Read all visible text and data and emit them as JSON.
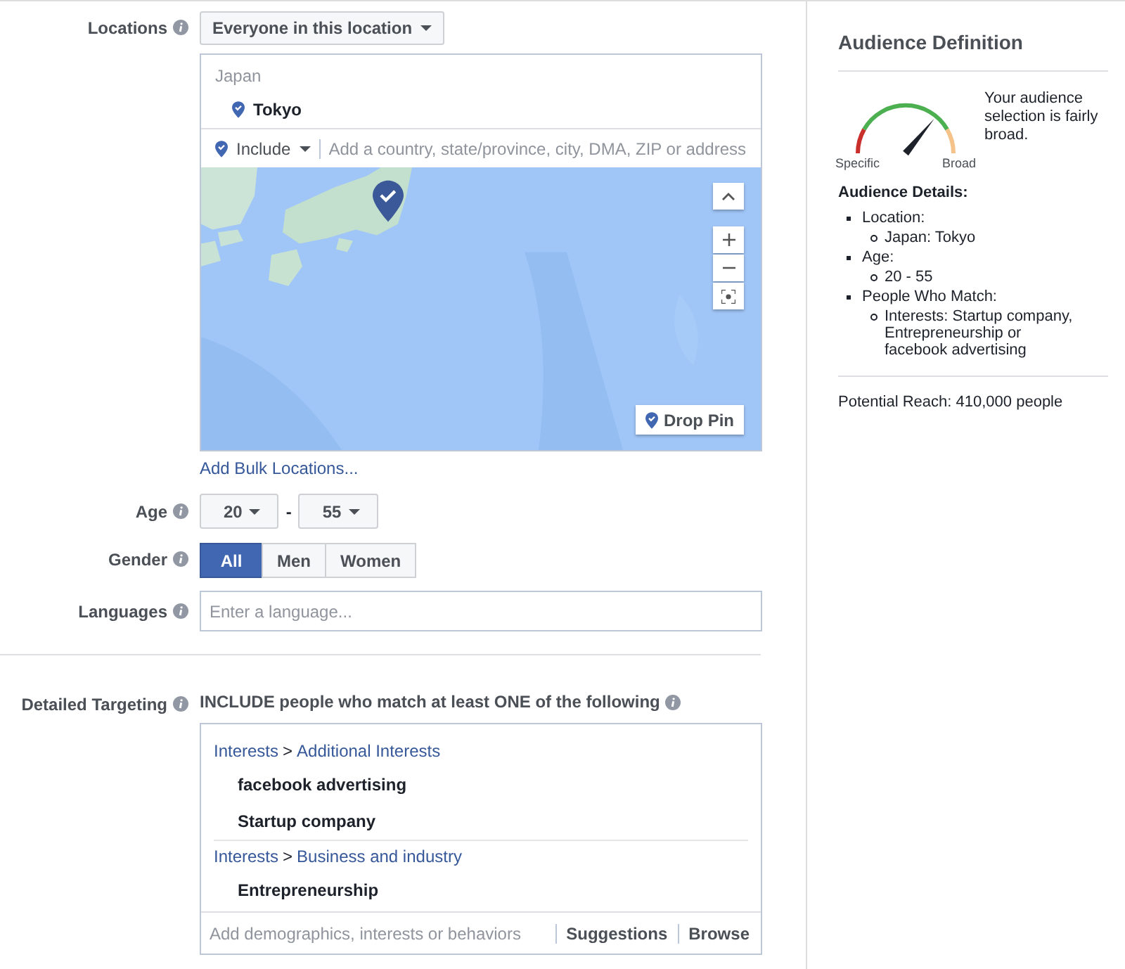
{
  "locations": {
    "label": "Locations",
    "mode": "Everyone in this location",
    "selected": [
      {
        "country": "Japan",
        "places": [
          "Tokyo"
        ]
      }
    ],
    "include": "Include",
    "search_placeholder": "Add a country, state/province, city, DMA, ZIP or address",
    "map": {
      "kind": "picture",
      "drop_pin": "Drop Pin"
    },
    "bulk_link": "Add Bulk Locations..."
  },
  "age": {
    "label": "Age",
    "min": "20",
    "separator": "-",
    "max": "55"
  },
  "gender": {
    "label": "Gender",
    "options": [
      {
        "label": "All",
        "selected": true
      },
      {
        "label": "Men",
        "selected": false
      },
      {
        "label": "Women",
        "selected": false
      }
    ]
  },
  "languages": {
    "label": "Languages",
    "placeholder": "Enter a language..."
  },
  "detailed_targeting": {
    "label": "Detailed Targeting",
    "heading": "INCLUDE people who match at least ONE of the following",
    "path_separator": ">",
    "groups": [
      {
        "path": [
          "Interests",
          "Additional Interests"
        ],
        "items": [
          "facebook advertising",
          "Startup company"
        ]
      },
      {
        "path": [
          "Interests",
          "Business and industry"
        ],
        "items": [
          "Entrepreneurship"
        ]
      }
    ],
    "placeholder": "Add demographics, interests or behaviors",
    "actions": [
      "Suggestions",
      "Browse"
    ]
  },
  "audience": {
    "title": "Audience Definition",
    "gauge": {
      "level": 0.72,
      "min_label": "Specific",
      "max_label": "Broad"
    },
    "summary": "Your audience selection is fairly broad.",
    "details_title": "Audience Details:",
    "details": [
      {
        "label": "Location:",
        "items": [
          "Japan: Tokyo"
        ]
      },
      {
        "label": "Age:",
        "items": [
          "20 - 55"
        ]
      },
      {
        "label": "People Who Match:",
        "items": [
          "Interests: Startup company, Entrepreneurship or facebook advertising"
        ]
      }
    ],
    "reach": "Potential Reach: 410,000 people"
  }
}
